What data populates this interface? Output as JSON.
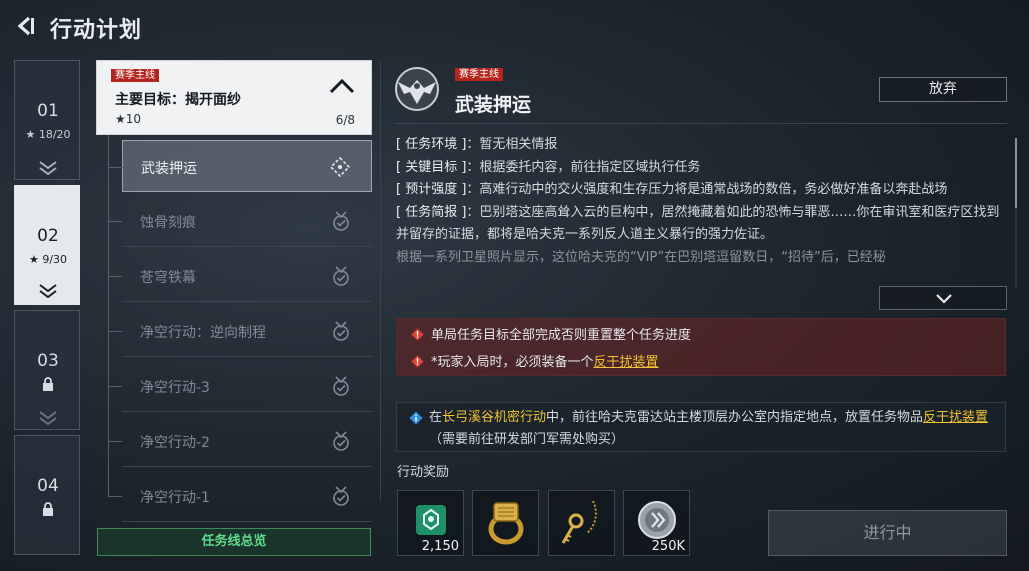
{
  "header": {
    "title": "行动计划"
  },
  "chapters": [
    {
      "num": "01",
      "stars": "★ 18/20",
      "locked": false,
      "active": false
    },
    {
      "num": "02",
      "stars": "★ 9/30",
      "locked": false,
      "active": true
    },
    {
      "num": "03",
      "stars": "",
      "locked": true,
      "active": false
    },
    {
      "num": "04",
      "stars": "",
      "locked": true,
      "active": false
    }
  ],
  "main_objective": {
    "tag": "赛季主线",
    "title": "主要目标：揭开面纱",
    "stars": "★10",
    "progress": "6/8"
  },
  "tasks": [
    {
      "label": "武装押运",
      "icon": "target-dashed-icon"
    },
    {
      "label": "蚀骨刻痕",
      "icon": "medal-check-icon"
    },
    {
      "label": "苍穹铁幕",
      "icon": "medal-check-icon"
    },
    {
      "label": "净空行动：逆向制程",
      "icon": "medal-check-icon"
    },
    {
      "label": "净空行动-3",
      "icon": "medal-check-icon"
    },
    {
      "label": "净空行动-2",
      "icon": "medal-check-icon"
    },
    {
      "label": "净空行动-1",
      "icon": "medal-check-icon"
    }
  ],
  "overview_label": "任务线总览",
  "detail": {
    "tag": "赛季主线",
    "title": "武装押运",
    "abandon_label": "放弃",
    "env_key": "[ 任务环境 ]",
    "env_val": "：暂无相关情报",
    "goal_key": "[ 关键目标 ]",
    "goal_val": "：根据委托内容，前往指定区域执行任务",
    "intensity_key": "[ 预计强度 ]",
    "intensity_val": "：高难行动中的交火强度和生存压力将是通常战场的数倍，务必做好准备以奔赴战场",
    "brief_key": "[ 任务简报 ]",
    "brief_val": "：巴别塔这座高耸入云的巨构中，居然掩藏着如此的恐怖与罪恶……你在审讯室和医疗区找到并留存的证据，都将是哈夫克一系列反人道主义暴行的强力佐证。",
    "brief_cut": "根据一系列卫星照片显示，这位哈夫克的“VIP”在巴别塔逗留数日，“招待”后，已经秘"
  },
  "warnings": {
    "line1": "单局任务目标全部完成否则重置整个任务进度",
    "line2_prefix": "*玩家入局时，必须装备一个",
    "line2_link": "反干扰装置"
  },
  "tip": {
    "pre": "在",
    "link1": "长弓溪谷机密行动",
    "mid": "中，前往哈夫克雷达站主楼顶层办公室内指定地点，放置任务物品",
    "link2": "反干扰装置",
    "post": "（需要前往研发部门军需处购买）"
  },
  "rewards_label": "行动奖励",
  "rewards": [
    {
      "icon": "green-emblem-icon",
      "qty": "2,150"
    },
    {
      "icon": "gold-ring-icon",
      "qty": ""
    },
    {
      "icon": "gold-pendant-icon",
      "qty": ""
    },
    {
      "icon": "silver-coin-icon",
      "qty": "250K"
    }
  ],
  "progress_label": "进行中",
  "colors": {
    "accent_red": "#b3261e",
    "link_yellow": "#f1c232",
    "green": "#5fd98a"
  }
}
